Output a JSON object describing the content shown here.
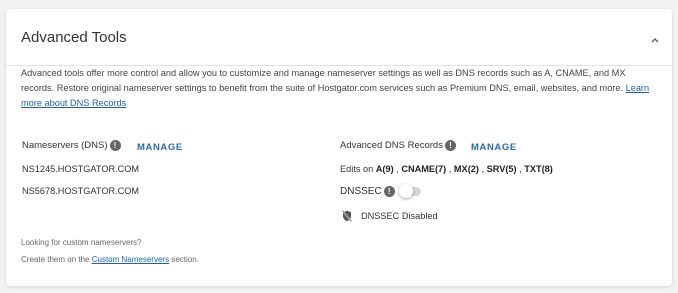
{
  "panel": {
    "title": "Advanced Tools",
    "collapse_icon": "chevron-up-icon"
  },
  "description": {
    "text": "Advanced tools offer more control and allow you to customize and manage nameserver settings as well as DNS records such as A, CNAME, and MX records. Restore original nameserver settings to benefit from the suite of Hostgator.com services such as Premium DNS, email, websites, and more. ",
    "link_label": "Learn more about DNS Records"
  },
  "nameservers": {
    "label": "Nameservers (DNS)",
    "info_icon": "!",
    "manage_label": "MANAGE",
    "items": [
      "NS1245.HOSTGATOR.COM",
      "NS5678.HOSTGATOR.COM"
    ]
  },
  "dns_records": {
    "label": "Advanced DNS Records",
    "info_icon": "!",
    "manage_label": "MANAGE",
    "edits_prefix": "Edits on",
    "edits": [
      "A(9)",
      "CNAME(7)",
      "MX(2)",
      "SRV(5)",
      "TXT(8)"
    ]
  },
  "dnssec": {
    "label": "DNSSEC",
    "info_icon": "!",
    "enabled": false,
    "status_text": "DNSSEC Disabled",
    "status_icon": "dnssec-disabled-icon"
  },
  "footer": {
    "line1": "Looking for custom nameservers?",
    "line2_prefix": "Create them on the",
    "line2_link": "Custom Nameservers",
    "line2_suffix": "section."
  },
  "colors": {
    "link": "#1f5fa8",
    "manage": "#2f6aa8",
    "background": "#f2f2f2",
    "card": "#ffffff"
  }
}
